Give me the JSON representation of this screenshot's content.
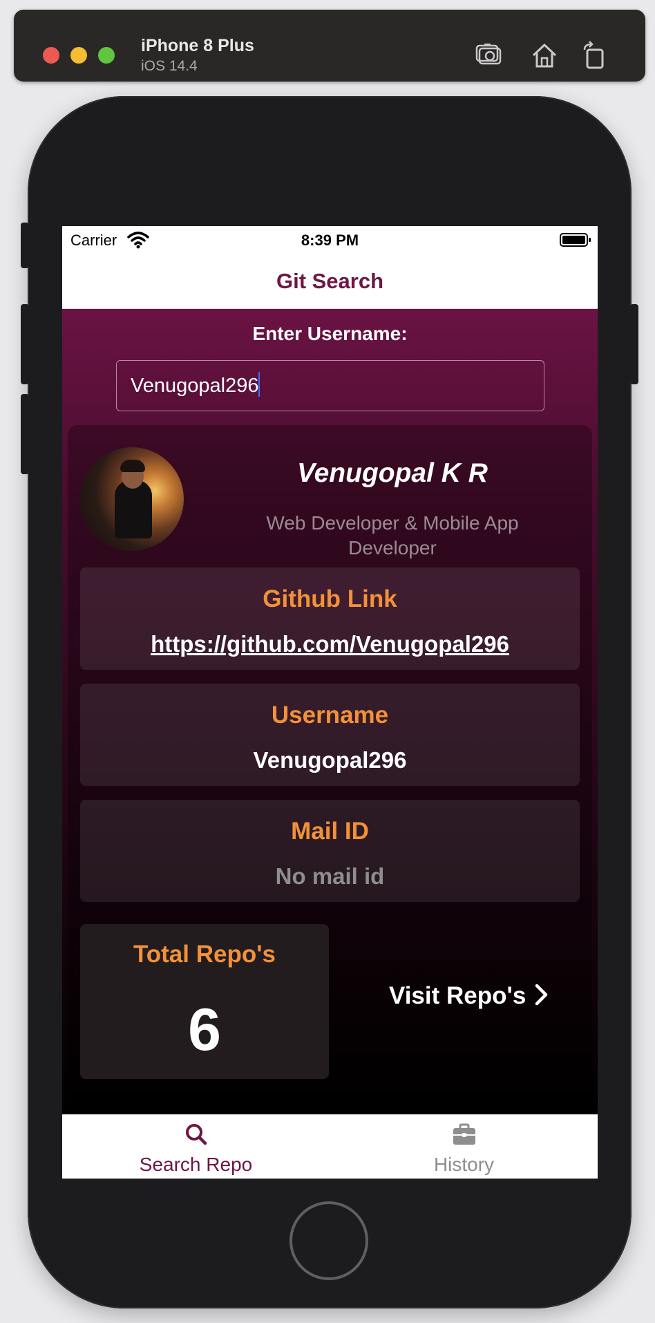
{
  "window": {
    "device_name": "iPhone 8 Plus",
    "os_version": "iOS 14.4",
    "toolbar_icons": [
      "screenshot-icon",
      "home-icon",
      "rotate-icon"
    ]
  },
  "status_bar": {
    "carrier": "Carrier",
    "time": "8:39 PM"
  },
  "nav": {
    "title": "Git Search"
  },
  "search": {
    "label": "Enter Username:",
    "value": "Venugopal296"
  },
  "profile": {
    "name": "Venugopal K R",
    "bio": "Web Developer & Mobile App Developer"
  },
  "github": {
    "title": "Github Link",
    "url": "https://github.com/Venugopal296"
  },
  "username": {
    "title": "Username",
    "value": "Venugopal296"
  },
  "mail": {
    "title": "Mail ID",
    "value": "No mail id"
  },
  "repos": {
    "title": "Total Repo's",
    "count": "6",
    "visit_label": "Visit Repo's"
  },
  "tabs": [
    {
      "label": "Search Repo",
      "icon": "search-icon",
      "active": true
    },
    {
      "label": "History",
      "icon": "briefcase-icon",
      "active": false
    }
  ],
  "colors": {
    "brand": "#6e1645",
    "accent": "#f2913a",
    "background_top": "#6b1344",
    "background_bottom": "#000000"
  }
}
